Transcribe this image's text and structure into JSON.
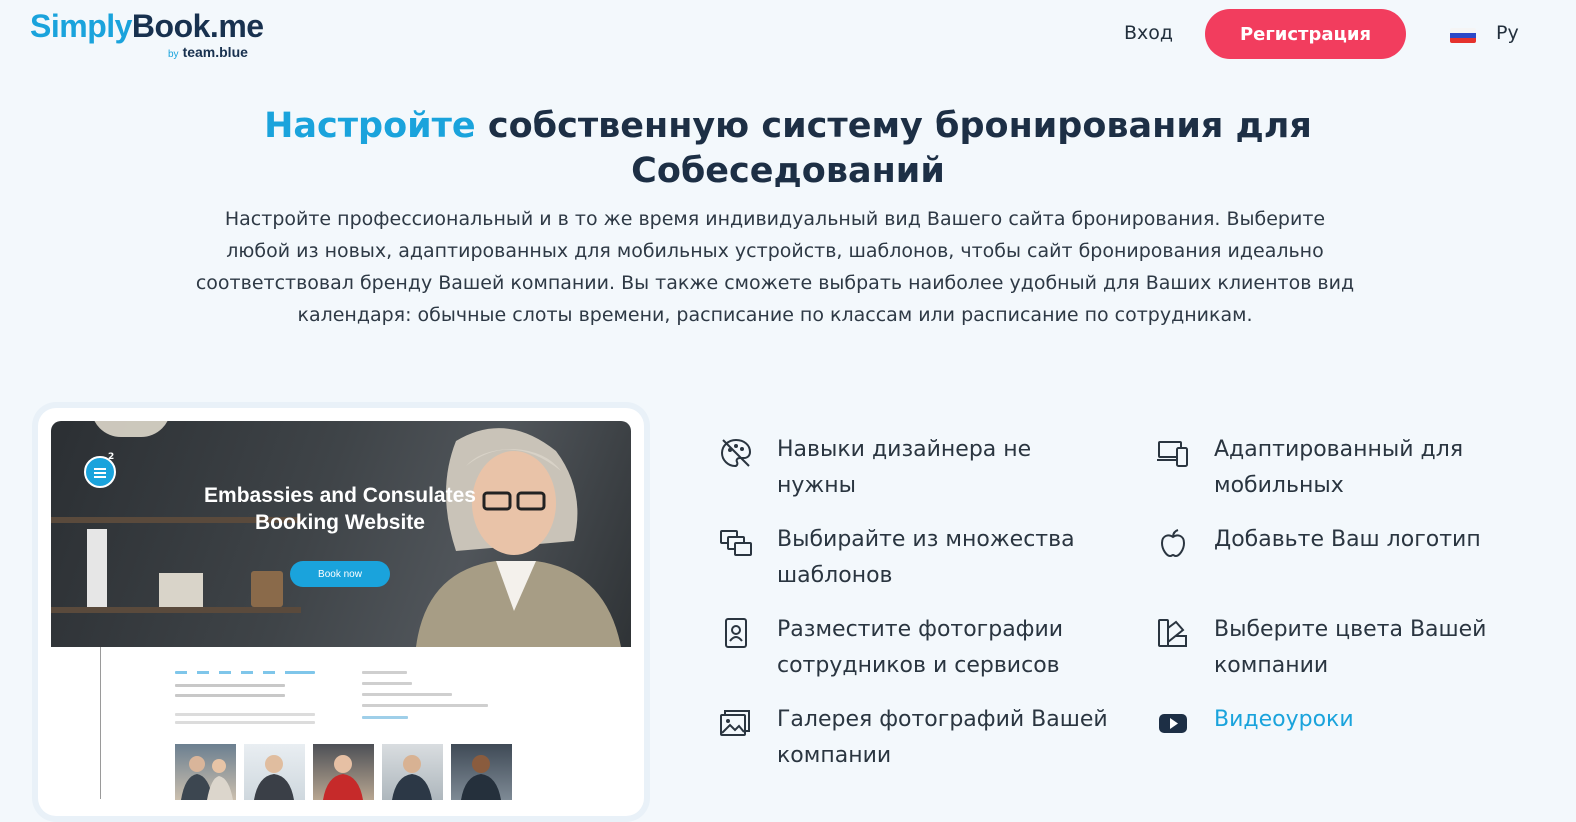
{
  "header": {
    "logo_main_part1": "Simply",
    "logo_main_part2": "Book.me",
    "logo_sub_by": "by",
    "logo_sub_brand": "team.blue",
    "login_label": "Вход",
    "signup_label": "Регистрация",
    "language_label": "Ру",
    "flag_icon": "russia-flag-icon"
  },
  "hero": {
    "title_accent": "Настройте",
    "title_rest": " собственную систему бронирования для Собеседований",
    "description": "Настройте профессиональный и в то же время индивидуальный вид Вашего сайта бронирования. Выберите любой из новых, адаптированных для мобильных устройств, шаблонов, чтобы сайт бронирования идеально соответствовал бренду Вашей компании. Вы также сможете выбрать наиболее удобный для Ваших клиентов вид календаря: обычные слоты времени, расписание по классам или расписание по сотрудникам."
  },
  "preview": {
    "title": "Embassies and Consulates Booking Website",
    "book_button": "Book now",
    "menu_badge": "2"
  },
  "features": [
    {
      "icon": "palette-crossed-icon",
      "label_line1": "Навыки дизайнера не",
      "label_line2": "нужны"
    },
    {
      "icon": "devices-icon",
      "label_line1": "Адаптированный для",
      "label_line2": "мобильных"
    },
    {
      "icon": "templates-icon",
      "label_line1": "Выбирайте из множества",
      "label_line2": "шаблонов"
    },
    {
      "icon": "apple-logo-icon",
      "label_line1": "Добавьте Ваш логотип",
      "label_line2": ""
    },
    {
      "icon": "badge-photo-icon",
      "label_line1": "Разместите фотографии",
      "label_line2": "сотрудников и сервисов"
    },
    {
      "icon": "color-swatches-icon",
      "label_line1": "Выберите цвета Вашей",
      "label_line2": "компании"
    },
    {
      "icon": "gallery-icon",
      "label_line1": "Галерея фотографий Вашей",
      "label_line2": "компании"
    },
    {
      "icon": "youtube-icon",
      "label_line1": "Видеоуроки",
      "label_line2": ""
    }
  ],
  "colors": {
    "accent": "#1aa3dc",
    "cta": "#f23d5e",
    "background": "#f3f8fc",
    "dark": "#1d2f45"
  }
}
